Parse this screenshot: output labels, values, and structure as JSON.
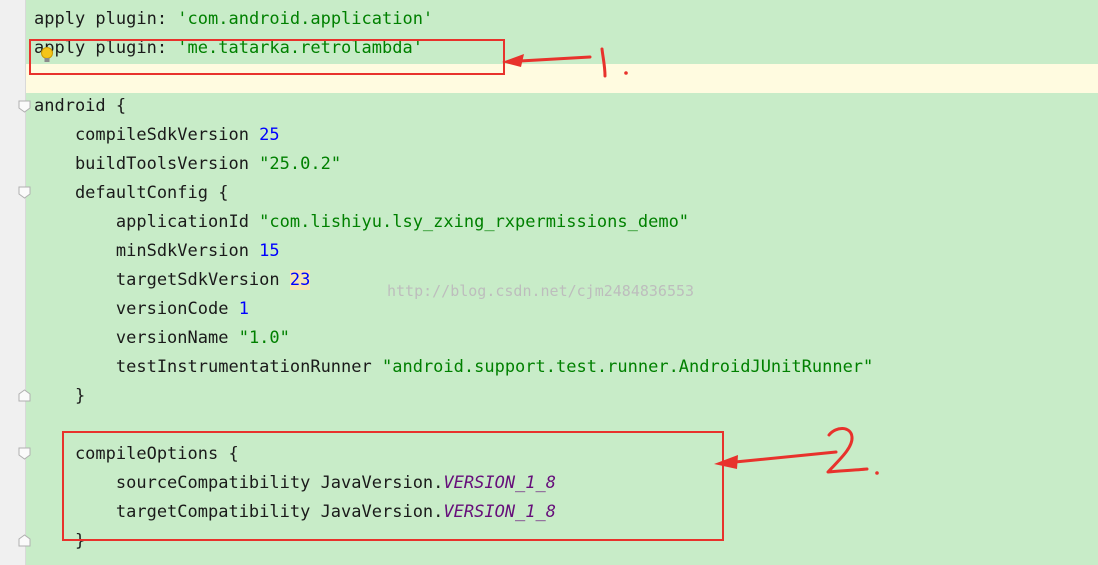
{
  "code_lines": [
    {
      "parts": [
        {
          "t": "apply plugin: ",
          "c": ""
        },
        {
          "t": "'com.android.application'",
          "c": "str"
        }
      ]
    },
    {
      "parts": [
        {
          "t": "apply plugin: ",
          "c": ""
        },
        {
          "t": "'me.tatarka.retrolambda'",
          "c": "str"
        }
      ]
    },
    {
      "parts": []
    },
    {
      "parts": [
        {
          "t": "android {",
          "c": ""
        }
      ]
    },
    {
      "parts": [
        {
          "t": "    compileSdkVersion ",
          "c": ""
        },
        {
          "t": "25",
          "c": "num"
        }
      ]
    },
    {
      "parts": [
        {
          "t": "    buildToolsVersion ",
          "c": ""
        },
        {
          "t": "\"25.0.2\"",
          "c": "str"
        }
      ]
    },
    {
      "parts": [
        {
          "t": "    defaultConfig {",
          "c": ""
        }
      ]
    },
    {
      "parts": [
        {
          "t": "        applicationId ",
          "c": ""
        },
        {
          "t": "\"com.lishiyu.lsy_zxing_rxpermissions_demo\"",
          "c": "str"
        }
      ]
    },
    {
      "parts": [
        {
          "t": "        minSdkVersion ",
          "c": ""
        },
        {
          "t": "15",
          "c": "num"
        }
      ]
    },
    {
      "parts": [
        {
          "t": "        targetSdkVersion ",
          "c": ""
        },
        {
          "t": "23",
          "c": "num num-hl"
        }
      ]
    },
    {
      "parts": [
        {
          "t": "        versionCode ",
          "c": ""
        },
        {
          "t": "1",
          "c": "num"
        }
      ]
    },
    {
      "parts": [
        {
          "t": "        versionName ",
          "c": ""
        },
        {
          "t": "\"1.0\"",
          "c": "str"
        }
      ]
    },
    {
      "parts": [
        {
          "t": "        testInstrumentationRunner ",
          "c": ""
        },
        {
          "t": "\"android.support.test.runner.AndroidJUnitRunner\"",
          "c": "str"
        }
      ]
    },
    {
      "parts": [
        {
          "t": "    }",
          "c": ""
        }
      ]
    },
    {
      "parts": []
    },
    {
      "parts": [
        {
          "t": "    compileOptions {",
          "c": ""
        }
      ]
    },
    {
      "parts": [
        {
          "t": "        sourceCompatibility JavaVersion.",
          "c": ""
        },
        {
          "t": "VERSION_1_8",
          "c": "const"
        }
      ]
    },
    {
      "parts": [
        {
          "t": "        targetCompatibility JavaVersion.",
          "c": ""
        },
        {
          "t": "VERSION_1_8",
          "c": "const"
        }
      ]
    },
    {
      "parts": [
        {
          "t": "    }",
          "c": ""
        }
      ]
    }
  ],
  "watermark": "http://blog.csdn.net/cjm2484836553",
  "annotations": [
    {
      "label": "1."
    },
    {
      "label": "2."
    }
  ],
  "colors": {
    "editor_bg": "#c8ecc8",
    "string": "#008000",
    "number": "#0000ff",
    "constant": "#660e7a",
    "annotation_red": "#e8322c"
  }
}
